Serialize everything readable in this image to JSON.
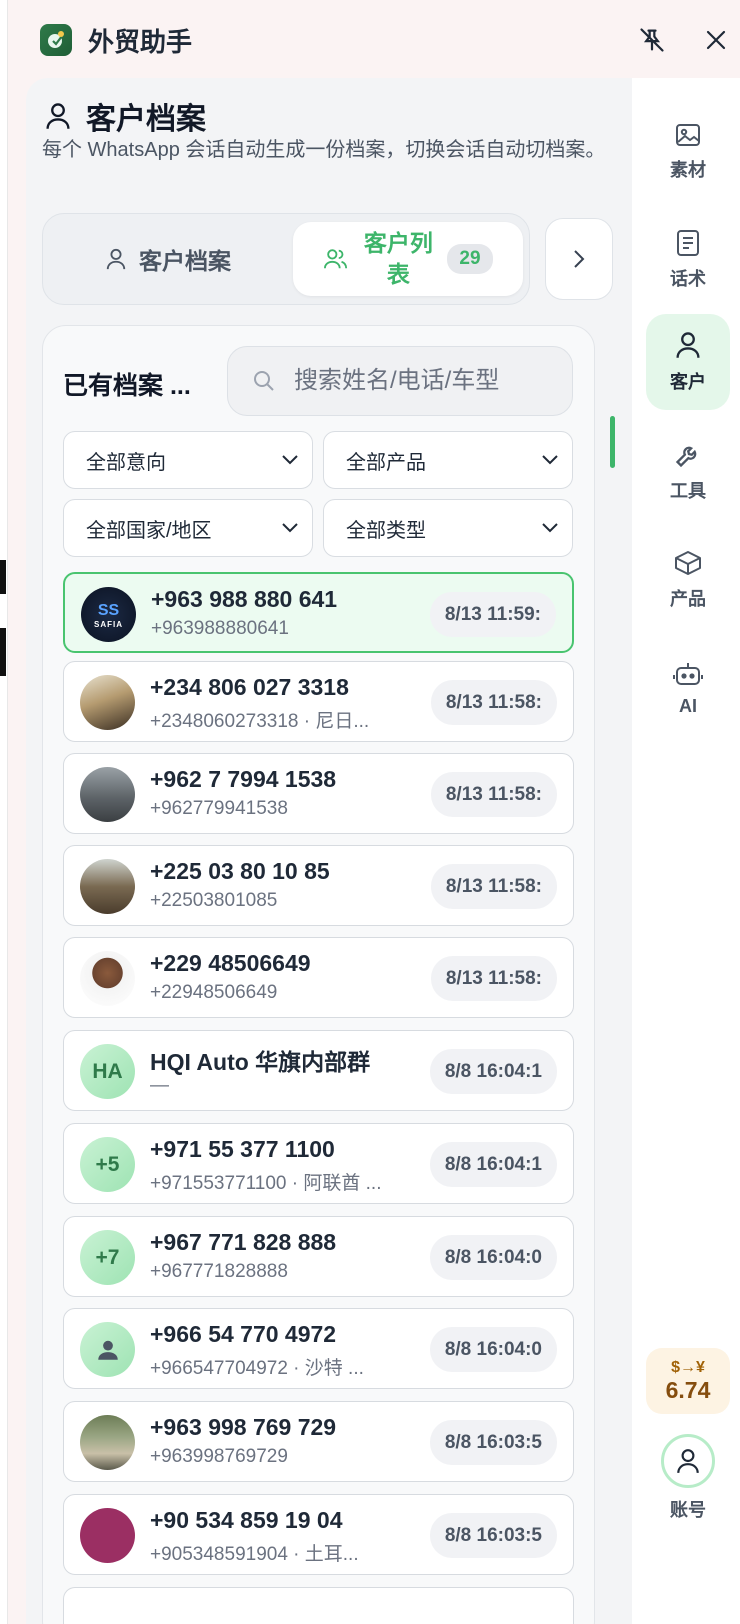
{
  "app": {
    "title": "外贸助手"
  },
  "section": {
    "title": "客户档案",
    "description": "每个 WhatsApp 会话自动生成一份档案，切换会话自动切档案。"
  },
  "tabs": {
    "profile_label": "客户档案",
    "list_label": "客户列表",
    "list_count": "29"
  },
  "list_panel": {
    "title": "已有档案 ...",
    "search_placeholder": "搜索姓名/电话/车型",
    "filters": {
      "intent": "全部意向",
      "product": "全部产品",
      "country": "全部国家/地区",
      "type": "全部类型"
    },
    "rows": [
      {
        "name": "+963 988 880 641",
        "sub": "+963988880641",
        "time": "8/13 11:59:",
        "avatar": "logo",
        "active": true
      },
      {
        "name": "+234 806 027 3318",
        "sub": "+2348060273318 · 尼日...",
        "time": "8/13 11:58:",
        "avatar": "photo"
      },
      {
        "name": "+962 7 7994 1538",
        "sub": "+962779941538",
        "time": "8/13 11:58:",
        "avatar": "photo"
      },
      {
        "name": "+225 03 80 10 85",
        "sub": "+22503801085",
        "time": "8/13 11:58:",
        "avatar": "photo"
      },
      {
        "name": "+229 48506649",
        "sub": "+22948506649",
        "time": "8/13 11:58:",
        "avatar": "photo"
      },
      {
        "name": "HQI Auto 华旗内部群",
        "sub": "—",
        "time": "8/8 16:04:1",
        "avatar": "HA"
      },
      {
        "name": "+971 55 377 1100",
        "sub": "+971553771100 · 阿联酋 ...",
        "time": "8/8 16:04:1",
        "avatar": "+5"
      },
      {
        "name": "+967 771 828 888",
        "sub": "+967771828888",
        "time": "8/8 16:04:0",
        "avatar": "+7"
      },
      {
        "name": "+966 54 770 4972",
        "sub": "+966547704972 · 沙特 ...",
        "time": "8/8 16:04:0",
        "avatar": "person"
      },
      {
        "name": "+963 998 769 729",
        "sub": "+963998769729",
        "time": "8/8 16:03:5",
        "avatar": "photo"
      },
      {
        "name": "+90 534 859 19 04",
        "sub": "+905348591904 · 土耳...",
        "time": "8/8 16:03:5",
        "avatar": "photo-magenta"
      }
    ]
  },
  "sidebar": {
    "items": [
      {
        "label": "素材",
        "icon": "image-icon"
      },
      {
        "label": "话术",
        "icon": "document-icon"
      },
      {
        "label": "客户",
        "icon": "user-icon",
        "active": true
      },
      {
        "label": "工具",
        "icon": "wrench-icon"
      },
      {
        "label": "产品",
        "icon": "box-icon"
      },
      {
        "label": "AI",
        "icon": "robot-icon"
      }
    ],
    "rate": {
      "label": "$→¥",
      "value": "6.74"
    },
    "account_label": "账号"
  },
  "colors": {
    "accent": "#3db56a",
    "active_row_bg": "#ecfbf1",
    "rate_bg": "#fdf3e3"
  }
}
